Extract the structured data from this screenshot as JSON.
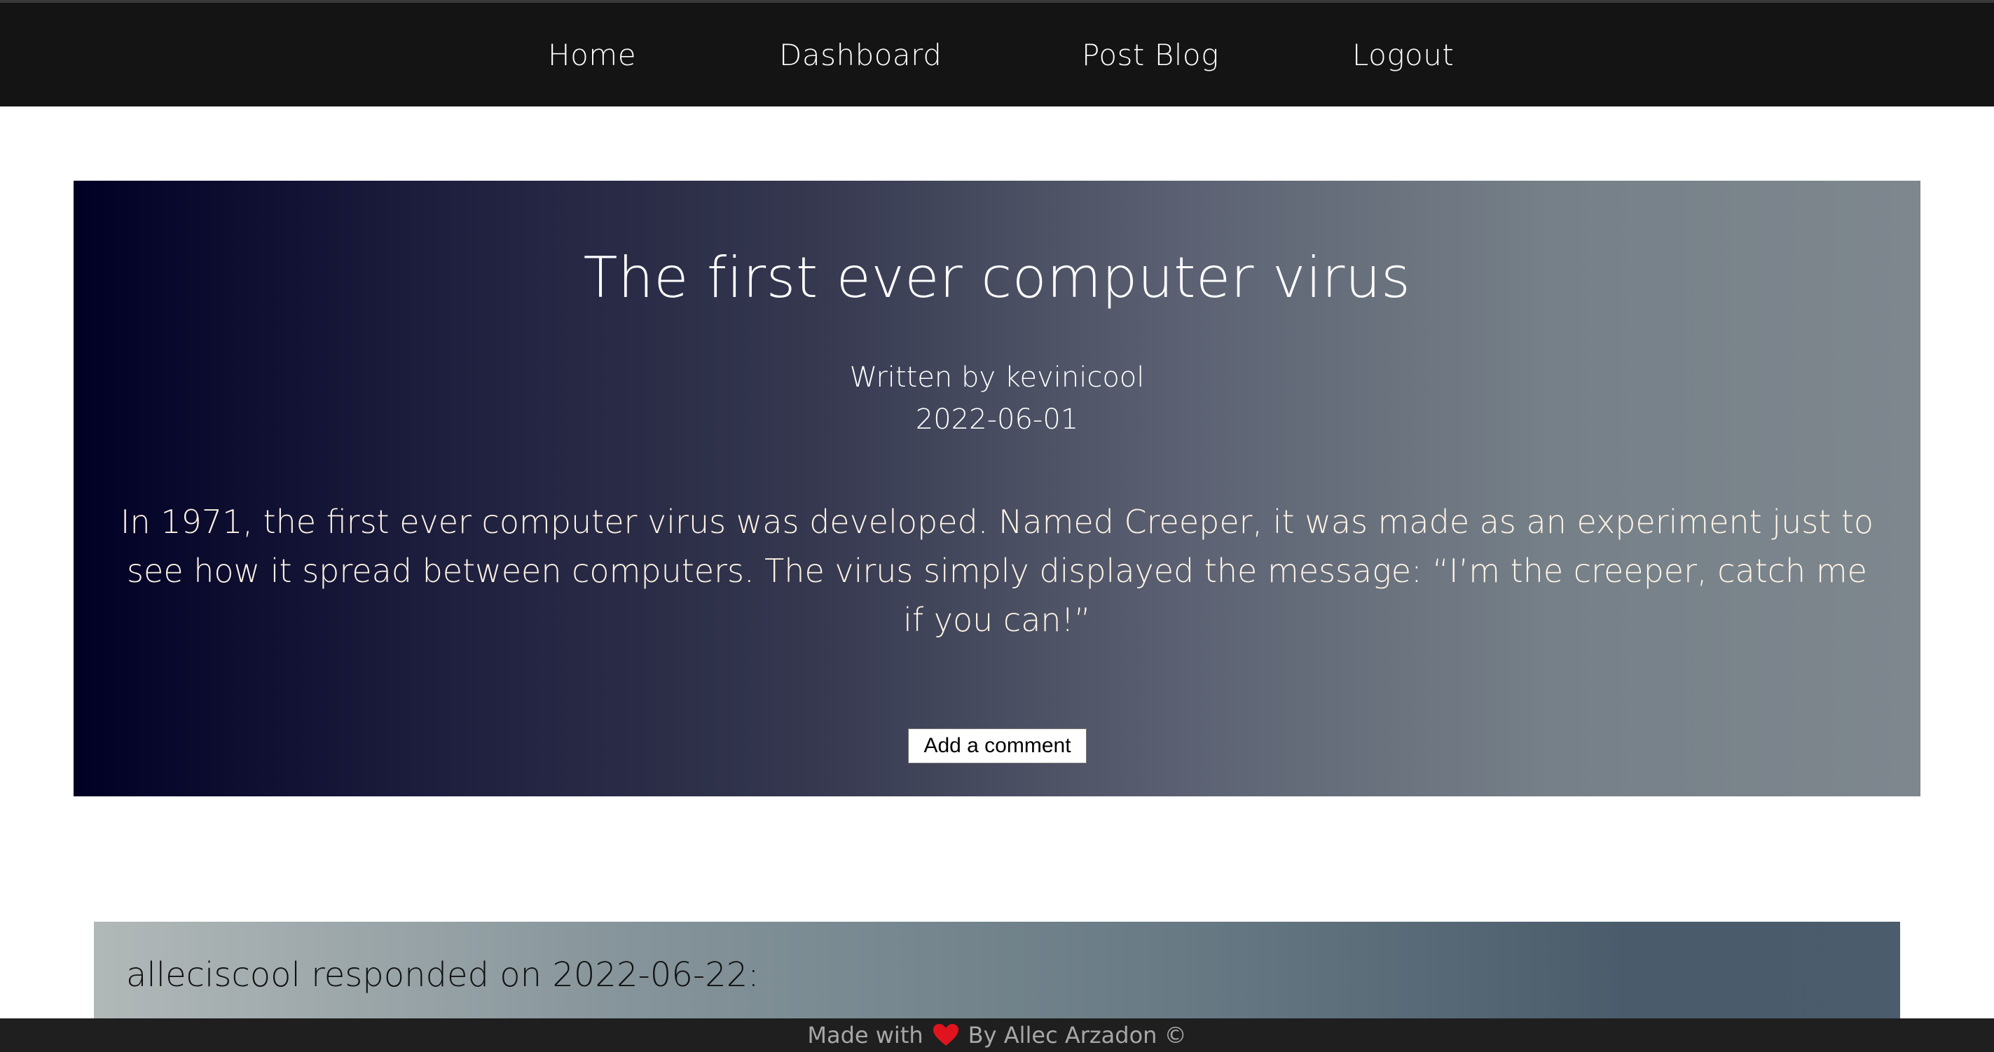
{
  "nav": {
    "home": "Home",
    "dashboard": "Dashboard",
    "post_blog": "Post Blog",
    "logout": "Logout"
  },
  "post": {
    "title": "The first ever computer virus",
    "author_line": "Written by kevinicool",
    "date": "2022-06-01",
    "body": "In 1971, the first ever computer virus was developed. Named Creeper, it was made as an experiment just to see how it spread between computers. The virus simply displayed the message: “I’m the creeper, catch me if you can!”",
    "comment_button": "Add a comment"
  },
  "comments": [
    {
      "header": "alleciscool responded on 2022-06-22:"
    }
  ],
  "footer": {
    "made_with": "Made with",
    "icon": "heart-icon",
    "by": "By Allec Arzadon ©",
    "heart_color": "#e0141e"
  }
}
